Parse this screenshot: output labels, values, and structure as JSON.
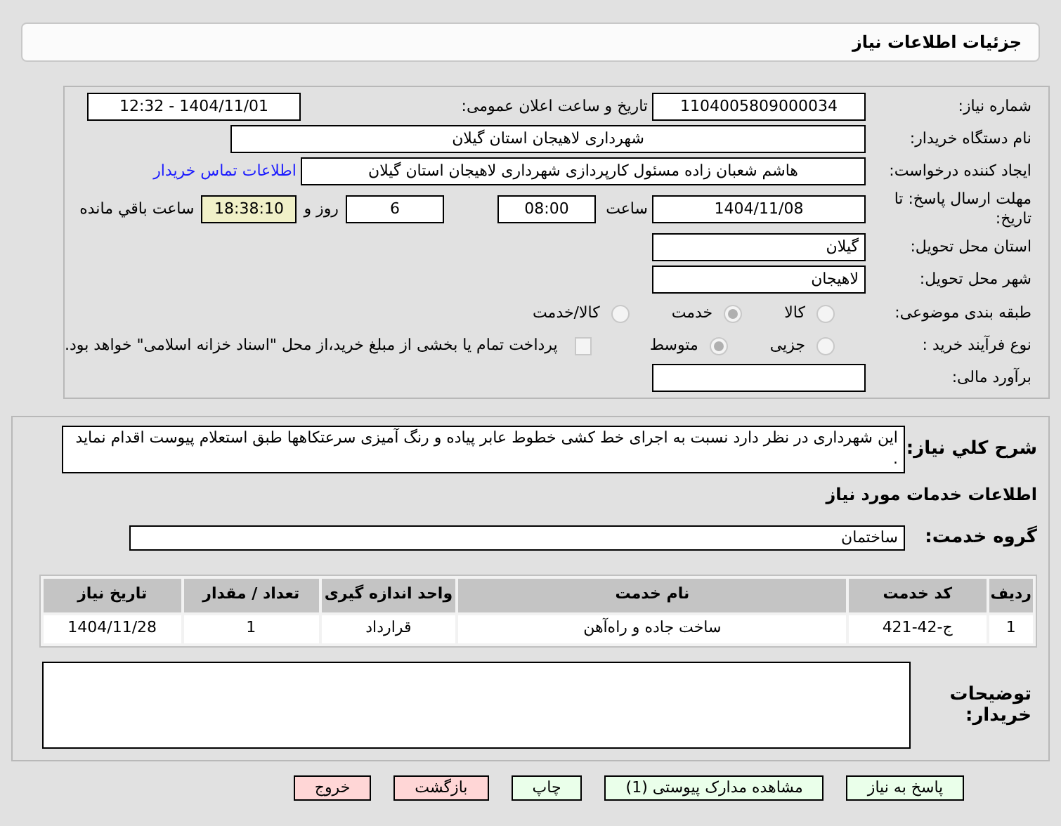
{
  "header": {
    "title": "جزئیات اطلاعات نیاز"
  },
  "details": {
    "need_number": {
      "label": "شماره نیاز:",
      "value": "1104005809000034"
    },
    "announce": {
      "label": "تاریخ و ساعت اعلان عمومی:",
      "value": "1404/11/01 - 12:32"
    },
    "buyer": {
      "label": "نام دستگاه خریدار:",
      "value": "شهرداری لاهیجان استان گیلان"
    },
    "creator": {
      "label": "ایجاد کننده درخواست:",
      "value": "هاشم شعبان زاده مسئول کارپردازی شهرداری لاهیجان استان گیلان",
      "link": "اطلاعات تماس خریدار"
    },
    "deadline": {
      "label": "مهلت ارسال پاسخ: تا تاریخ:",
      "date": "1404/11/08",
      "time_label": "ساعت",
      "time": "08:00",
      "days": "6",
      "days_label": "روز و",
      "remaining": "18:38:10",
      "remaining_label": "ساعت باقي مانده"
    },
    "province": {
      "label": "استان محل تحویل:",
      "value": "گیلان"
    },
    "city": {
      "label": "شهر محل تحویل:",
      "value": "لاهیجان"
    },
    "classification": {
      "label": "طبقه بندی موضوعی:",
      "options": [
        {
          "label": "کالا",
          "selected": false
        },
        {
          "label": "خدمت",
          "selected": true
        },
        {
          "label": "کالا/خدمت",
          "selected": false
        }
      ]
    },
    "purchase_type": {
      "label": "نوع فرآیند خرید :",
      "options": [
        {
          "label": "جزیی",
          "selected": false
        },
        {
          "label": "متوسط",
          "selected": true
        }
      ],
      "payment": {
        "checked": false,
        "label": "پرداخت تمام یا بخشی از مبلغ خرید،از محل \"اسناد خزانه اسلامی\" خواهد بود."
      }
    },
    "budget": {
      "label": "برآورد مالی:"
    }
  },
  "services": {
    "description": {
      "label": "شرح کلي نیاز:",
      "value": "این شهرداری  در نظر دارد نسبت به اجرای خط کشی خطوط عابر پیاده و رنگ آمیزی سرعتکاهها طبق استعلام پیوست اقدام نماید ."
    },
    "heading": "اطلاعات خدمات مورد نیاز",
    "group": {
      "label": "گروه خدمت:",
      "value": "ساختمان"
    },
    "table": {
      "columns": [
        "ردیف",
        "کد خدمت",
        "نام خدمت",
        "واحد اندازه گیری",
        "تعداد / مقدار",
        "تاریخ نیاز"
      ],
      "rows": [
        [
          "1",
          "ج-42-421",
          "ساخت جاده و راه‌آهن",
          "قرارداد",
          "1",
          "1404/11/28"
        ]
      ]
    },
    "buyer_notes": {
      "label": "توضیحات خریدار:"
    }
  },
  "buttons": [
    {
      "label": "پاسخ به نیاز",
      "color": "#eaffea"
    },
    {
      "label": "مشاهده مدارک پیوستی (1)",
      "color": "#eaffea"
    },
    {
      "label": "چاپ",
      "color": "#eaffea"
    },
    {
      "label": "بازگشت",
      "color": "#ffd6d6"
    },
    {
      "label": "خروج",
      "color": "#ffd6d6"
    }
  ]
}
